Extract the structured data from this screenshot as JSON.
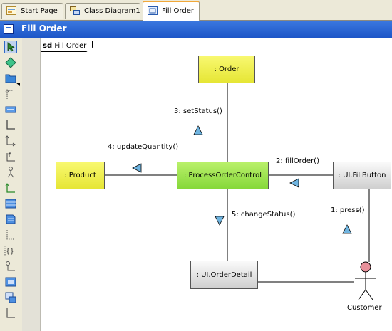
{
  "tabs": [
    {
      "label": "Start Page",
      "icon": "start-page-icon",
      "active": false
    },
    {
      "label": "Class Diagram1",
      "icon": "class-diagram-icon",
      "active": false
    },
    {
      "label": "Fill Order",
      "icon": "communication-diagram-icon",
      "active": true
    }
  ],
  "title": "Fill Order",
  "diagram": {
    "frame_prefix": "sd",
    "frame_name": "Fill Order",
    "nodes": {
      "order": ": Order",
      "product": ": Product",
      "process": ": ProcessOrderControl",
      "fillbutton": ": UI.FillButton",
      "orderdetail": ": UI.OrderDetail"
    },
    "actor": "Customer",
    "messages": {
      "m1": "1: press()",
      "m2": "2: fillOrder()",
      "m3": "3: setStatus()",
      "m4": "4: updateQuantity()",
      "m5": "5: changeStatus()"
    }
  },
  "toolbar_tools": [
    "select-tool-icon",
    "sweeper-tool-icon",
    "lifeline-tool-icon",
    "dotted-connector-tool-icon",
    "lifeline-box-tool-icon",
    "message-tool-icon",
    "return-message-tool-icon",
    "self-message-tool-icon",
    "actor-tool-icon",
    "create-message-tool-icon",
    "fragment-tool-icon",
    "note-tool-icon",
    "anchor-tool-icon",
    "constraint-tool-icon",
    "link-tool-icon",
    "interaction-use-tool-icon",
    "gate-tool-icon",
    "continuation-tool-icon"
  ],
  "colors": {
    "title_bar": "#2a66d8",
    "class_node": "#eeee45",
    "control_node": "#9ee24c",
    "boundary_node": "#e2e2e2",
    "arrow_fill": "#6fb4e0",
    "actor_head": "#e7909a"
  }
}
